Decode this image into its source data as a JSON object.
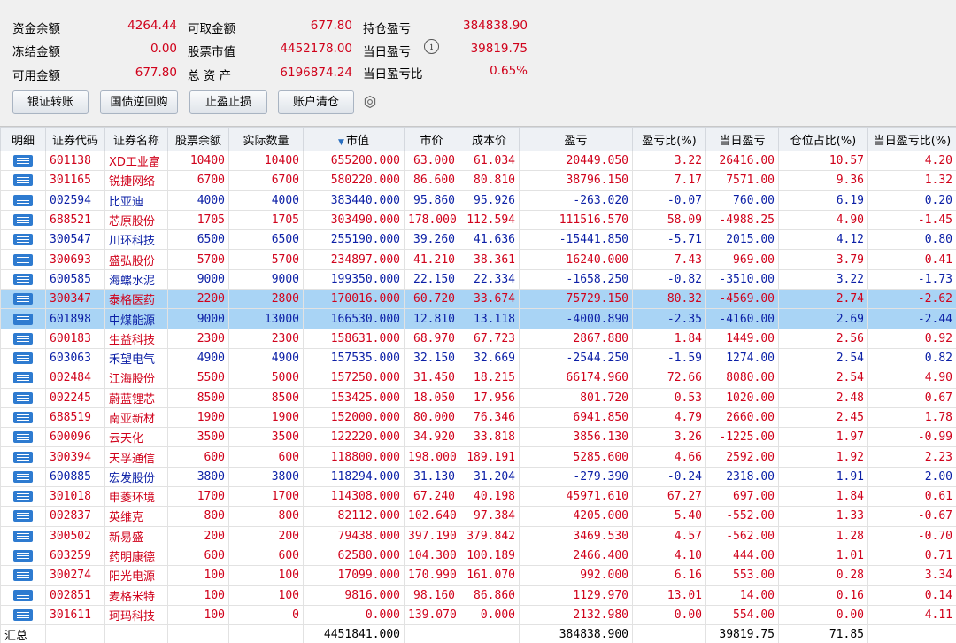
{
  "summary": {
    "cash_balance_label": "资金余额",
    "cash_balance": "4264.44",
    "frozen_label": "冻结金额",
    "frozen": "0.00",
    "available_label": "可用金额",
    "available": "677.80",
    "withdrawable_label": "可取金额",
    "withdrawable": "677.80",
    "stock_value_label": "股票市值",
    "stock_value": "4452178.00",
    "total_assets_label": "总 资 产",
    "total_assets": "6196874.24",
    "position_pnl_label": "持仓盈亏",
    "position_pnl": "384838.90",
    "today_pnl_label": "当日盈亏",
    "today_pnl": "39819.75",
    "today_pnl_ratio_label": "当日盈亏比",
    "today_pnl_ratio": "0.65%",
    "info_icon": "i"
  },
  "buttons": {
    "bank_transfer": "银证转账",
    "reverse_repo": "国债逆回购",
    "take_profit": "止盈止损",
    "clear_account": "账户清仓"
  },
  "columns": [
    "明细",
    "证券代码",
    "证券名称",
    "股票余额",
    "实际数量",
    "市值",
    "市价",
    "成本价",
    "盈亏",
    "盈亏比(%)",
    "当日盈亏",
    "仓位占比(%)",
    "当日盈亏比(%)"
  ],
  "colors": {
    "up": "#d0021b",
    "down": "#0b1fa6",
    "selected": "#a9d4f5",
    "icon": "#2e7bd0"
  },
  "rows": [
    {
      "dir": "up",
      "sel": false,
      "cells": [
        "601138",
        "XD工业富",
        "10400",
        "10400",
        "655200.000",
        "63.000",
        "61.034",
        "20449.050",
        "3.22",
        "26416.00",
        "10.57",
        "4.20"
      ]
    },
    {
      "dir": "up",
      "sel": false,
      "cells": [
        "301165",
        "锐捷网络",
        "6700",
        "6700",
        "580220.000",
        "86.600",
        "80.810",
        "38796.150",
        "7.17",
        "7571.00",
        "9.36",
        "1.32"
      ]
    },
    {
      "dir": "down",
      "sel": false,
      "cells": [
        "002594",
        "比亚迪",
        "4000",
        "4000",
        "383440.000",
        "95.860",
        "95.926",
        "-263.020",
        "-0.07",
        "760.00",
        "6.19",
        "0.20"
      ]
    },
    {
      "dir": "up",
      "sel": false,
      "cells": [
        "688521",
        "芯原股份",
        "1705",
        "1705",
        "303490.000",
        "178.000",
        "112.594",
        "111516.570",
        "58.09",
        "-4988.25",
        "4.90",
        "-1.45"
      ]
    },
    {
      "dir": "down",
      "sel": false,
      "cells": [
        "300547",
        "川环科技",
        "6500",
        "6500",
        "255190.000",
        "39.260",
        "41.636",
        "-15441.850",
        "-5.71",
        "2015.00",
        "4.12",
        "0.80"
      ]
    },
    {
      "dir": "up",
      "sel": false,
      "cells": [
        "300693",
        "盛弘股份",
        "5700",
        "5700",
        "234897.000",
        "41.210",
        "38.361",
        "16240.000",
        "7.43",
        "969.00",
        "3.79",
        "0.41"
      ]
    },
    {
      "dir": "down",
      "sel": false,
      "cells": [
        "600585",
        "海螺水泥",
        "9000",
        "9000",
        "199350.000",
        "22.150",
        "22.334",
        "-1658.250",
        "-0.82",
        "-3510.00",
        "3.22",
        "-1.73"
      ]
    },
    {
      "dir": "up",
      "sel": true,
      "cells": [
        "300347",
        "泰格医药",
        "2200",
        "2800",
        "170016.000",
        "60.720",
        "33.674",
        "75729.150",
        "80.32",
        "-4569.00",
        "2.74",
        "-2.62"
      ]
    },
    {
      "dir": "down",
      "sel": true,
      "cells": [
        "601898",
        "中煤能源",
        "9000",
        "13000",
        "166530.000",
        "12.810",
        "13.118",
        "-4000.890",
        "-2.35",
        "-4160.00",
        "2.69",
        "-2.44"
      ]
    },
    {
      "dir": "up",
      "sel": false,
      "cells": [
        "600183",
        "生益科技",
        "2300",
        "2300",
        "158631.000",
        "68.970",
        "67.723",
        "2867.880",
        "1.84",
        "1449.00",
        "2.56",
        "0.92"
      ]
    },
    {
      "dir": "down",
      "sel": false,
      "cells": [
        "603063",
        "禾望电气",
        "4900",
        "4900",
        "157535.000",
        "32.150",
        "32.669",
        "-2544.250",
        "-1.59",
        "1274.00",
        "2.54",
        "0.82"
      ]
    },
    {
      "dir": "up",
      "sel": false,
      "cells": [
        "002484",
        "江海股份",
        "5500",
        "5000",
        "157250.000",
        "31.450",
        "18.215",
        "66174.960",
        "72.66",
        "8080.00",
        "2.54",
        "4.90"
      ]
    },
    {
      "dir": "up",
      "sel": false,
      "cells": [
        "002245",
        "蔚蓝锂芯",
        "8500",
        "8500",
        "153425.000",
        "18.050",
        "17.956",
        "801.720",
        "0.53",
        "1020.00",
        "2.48",
        "0.67"
      ]
    },
    {
      "dir": "up",
      "sel": false,
      "cells": [
        "688519",
        "南亚新材",
        "1900",
        "1900",
        "152000.000",
        "80.000",
        "76.346",
        "6941.850",
        "4.79",
        "2660.00",
        "2.45",
        "1.78"
      ]
    },
    {
      "dir": "up",
      "sel": false,
      "cells": [
        "600096",
        "云天化",
        "3500",
        "3500",
        "122220.000",
        "34.920",
        "33.818",
        "3856.130",
        "3.26",
        "-1225.00",
        "1.97",
        "-0.99"
      ]
    },
    {
      "dir": "up",
      "sel": false,
      "cells": [
        "300394",
        "天孚通信",
        "600",
        "600",
        "118800.000",
        "198.000",
        "189.191",
        "5285.600",
        "4.66",
        "2592.00",
        "1.92",
        "2.23"
      ]
    },
    {
      "dir": "down",
      "sel": false,
      "cells": [
        "600885",
        "宏发股份",
        "3800",
        "3800",
        "118294.000",
        "31.130",
        "31.204",
        "-279.390",
        "-0.24",
        "2318.00",
        "1.91",
        "2.00"
      ]
    },
    {
      "dir": "up",
      "sel": false,
      "cells": [
        "301018",
        "申菱环境",
        "1700",
        "1700",
        "114308.000",
        "67.240",
        "40.198",
        "45971.610",
        "67.27",
        "697.00",
        "1.84",
        "0.61"
      ]
    },
    {
      "dir": "up",
      "sel": false,
      "cells": [
        "002837",
        "英维克",
        "800",
        "800",
        "82112.000",
        "102.640",
        "97.384",
        "4205.000",
        "5.40",
        "-552.00",
        "1.33",
        "-0.67"
      ]
    },
    {
      "dir": "up",
      "sel": false,
      "cells": [
        "300502",
        "新易盛",
        "200",
        "200",
        "79438.000",
        "397.190",
        "379.842",
        "3469.530",
        "4.57",
        "-562.00",
        "1.28",
        "-0.70"
      ]
    },
    {
      "dir": "up",
      "sel": false,
      "cells": [
        "603259",
        "药明康德",
        "600",
        "600",
        "62580.000",
        "104.300",
        "100.189",
        "2466.400",
        "4.10",
        "444.00",
        "1.01",
        "0.71"
      ]
    },
    {
      "dir": "up",
      "sel": false,
      "cells": [
        "300274",
        "阳光电源",
        "100",
        "100",
        "17099.000",
        "170.990",
        "161.070",
        "992.000",
        "6.16",
        "553.00",
        "0.28",
        "3.34"
      ]
    },
    {
      "dir": "up",
      "sel": false,
      "cells": [
        "002851",
        "麦格米特",
        "100",
        "100",
        "9816.000",
        "98.160",
        "86.860",
        "1129.970",
        "13.01",
        "14.00",
        "0.16",
        "0.14"
      ]
    },
    {
      "dir": "up",
      "sel": false,
      "cells": [
        "301611",
        "珂玛科技",
        "100",
        "0",
        "0.000",
        "139.070",
        "0.000",
        "2132.980",
        "0.00",
        "554.00",
        "0.00",
        "4.11"
      ]
    }
  ],
  "total": {
    "label": "汇总",
    "market_value": "4451841.000",
    "pnl": "384838.900",
    "today_pnl": "39819.75",
    "position_ratio": "71.85"
  }
}
